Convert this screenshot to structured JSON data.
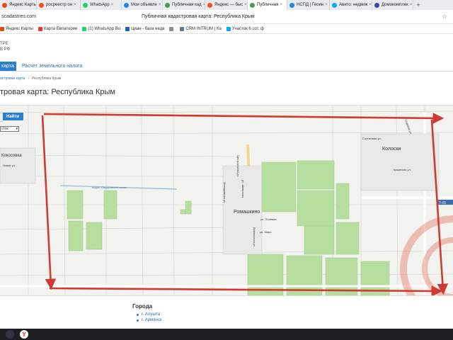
{
  "tabs": [
    {
      "label": "Яндекс Карты",
      "color": "#e64a19",
      "active": false
    },
    {
      "label": "росреестр он",
      "color": "#f4511e",
      "active": false
    },
    {
      "label": "WhatsApp",
      "color": "#25d366",
      "active": false
    },
    {
      "label": "Мои объявле",
      "color": "#1e88e5",
      "active": false
    },
    {
      "label": "Публичная кад",
      "color": "#43a047",
      "active": false
    },
    {
      "label": "Яндекс — быс",
      "color": "#f4511e",
      "active": false
    },
    {
      "label": "Публичная",
      "color": "#43a047",
      "active": true
    },
    {
      "label": "НСПД | Геоин",
      "color": "#1e88e5",
      "active": false
    },
    {
      "label": "Авито: недвиж",
      "color": "#00aaff",
      "active": false
    },
    {
      "label": "Домокомплек",
      "color": "#3949ab",
      "active": false
    }
  ],
  "address": {
    "url": "scadastres.com",
    "page_title": "Публичная кадастровая карта: Республика Крым"
  },
  "bookmarks": [
    {
      "label": "Яндекс Карты",
      "color": "#e64a19"
    },
    {
      "label": "Карта Евпатории",
      "color": "#e53935"
    },
    {
      "label": "(1) WhatsApp Bu",
      "color": "#25d366"
    },
    {
      "label": "Циан - база недв",
      "color": "#1565c0"
    },
    {
      "label": "",
      "color": "#8e8e8e"
    },
    {
      "label": "CRM INTRUM | Ка",
      "color": "#607d8b"
    },
    {
      "label": "Участок 6 сот. ф",
      "color": "#00aaff"
    }
  ],
  "header": {
    "org_line1": "ТРЕ",
    "org_line2": "В РФ",
    "nav_active": "карта",
    "nav_link": "Расчет земельного налога"
  },
  "breadcrumb": {
    "item1": "астровая карта",
    "sep": "›",
    "item2": "Республика Крым"
  },
  "heading": "тровая карта: Республика Крым",
  "map": {
    "find_button": "Найти",
    "select_value": "сток",
    "labels": {
      "village_left": "Кокосовка",
      "village_center": "Ромашкино",
      "village_right": "Колоски",
      "reservoir": "водох. Сидоровский канал",
      "street_v1": "Центральная ул.",
      "street_v2": "ул. Шевченко",
      "street_v3": "Вокзальная ул.",
      "street_v4": "Молодежная ул.",
      "street_v5": "ул. Мира",
      "street_v6": "ул. Полевая",
      "street_r1": "Садовая ул.",
      "street_r2": "Крымская ул.",
      "street_r3": "Солнечная ул.",
      "street_l1": "Новая ул.",
      "road_badge": "Т-01"
    }
  },
  "cities": {
    "title": "Города",
    "items": [
      "г. Алушта",
      "г. Армянск"
    ]
  },
  "annotation_color": "#cf3a32"
}
